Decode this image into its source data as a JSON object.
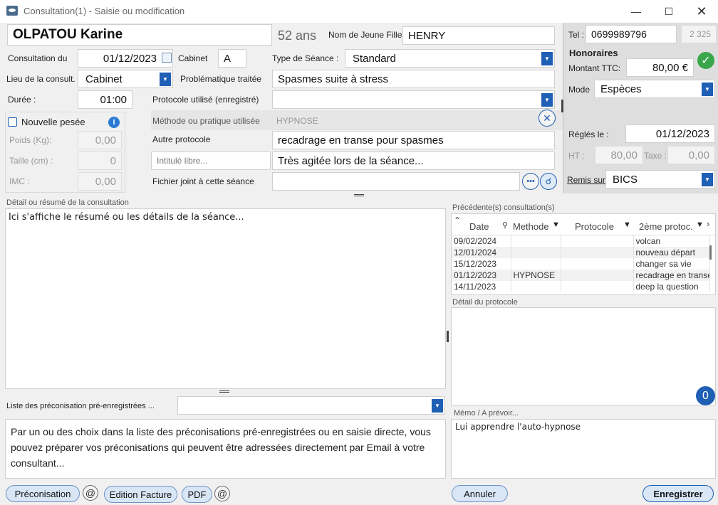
{
  "window": {
    "title": "Consultation(1) - Saisie ou modification"
  },
  "patient": {
    "name": "OLPATOU Karine",
    "age": "52 ans",
    "maiden_label": "Nom de Jeune Fille",
    "maiden_value": "HENRY"
  },
  "form": {
    "consult_date_label": "Consultation du",
    "consult_date": "01/12/2023",
    "cabinet_label": "Cabinet",
    "cabinet": "A",
    "session_type_label": "Type de Séance :",
    "session_type": "Standard",
    "place_label": "Lieu de la consult.",
    "place": "Cabinet",
    "problem_label": "Problématique traitée",
    "problem": "Spasmes suite à stress",
    "duration_label": "Durée :",
    "duration": "01:00",
    "protocol_label": "Protocole utilisé (enregistré)",
    "protocol": "",
    "method_label": "Méthode ou pratique utilisée",
    "method": "HYPNOSE",
    "other_protocol_label": "Autre protocole",
    "other_protocol": "recadrage en transe pour spasmes",
    "free_title_placeholder": "Intitulé libre...",
    "free_title_value": "Très agitée lors de la séance...",
    "attached_label": "Fichier joint à cette séance",
    "attached": ""
  },
  "weigh": {
    "new_label": "Nouvelle pesée",
    "weight_label": "Poids (Kg):",
    "weight": "0,00",
    "height_label": "Taille (cm) :",
    "height": "0",
    "imc_label": "IMC :",
    "imc": "0,00"
  },
  "billing": {
    "tel_label": "Tel :",
    "tel": "0699989796",
    "code": "2 325",
    "fees_title": "Honoraires",
    "amount_label": "Montant TTC:",
    "amount": "80,00 €",
    "mode_label": "Mode",
    "mode": "Espèces",
    "paid_label": "Réglés le :",
    "paid_date": "01/12/2023",
    "ht_label": "HT :",
    "ht": "80,00",
    "tax_label": "Taxe :",
    "tax": "0,00",
    "remis_label": "Remis sur",
    "remis": "BICS"
  },
  "detail": {
    "label": "Détail ou résumé de la consultation",
    "text": "Ici s'affiche le résumé ou les détails de la séance..."
  },
  "history": {
    "label": "Précédente(s) consultation(s)",
    "columns": [
      "Date",
      "Methode",
      "Protocole",
      "2ème protoc."
    ],
    "rows": [
      {
        "date": "09/02/2024",
        "method": "",
        "protocol": "",
        "second": "volcan"
      },
      {
        "date": "12/01/2024",
        "method": "",
        "protocol": "",
        "second": "nouveau départ"
      },
      {
        "date": "15/12/2023",
        "method": "",
        "protocol": "",
        "second": "changer sa vie"
      },
      {
        "date": "01/12/2023",
        "method": "HYPNOSE",
        "protocol": "",
        "second": "recadrage en transe"
      },
      {
        "date": "14/11/2023",
        "method": "",
        "protocol": "",
        "second": "deep la question"
      }
    ]
  },
  "protocol_detail": {
    "label": "Détail du protocole",
    "badge": "0"
  },
  "preco": {
    "list_label": "Liste des préconisation pré-enregistrées ...",
    "text": "Par un ou des choix dans la liste des préconisations pré-enregistrées ou en saisie directe, vous pouvez préparer vos préconisations qui peuvent être adressées directement par Email à votre consultant..."
  },
  "memo": {
    "label": "Mémo / A prévoir...",
    "text": "Lui apprendre l'auto-hypnose"
  },
  "buttons": {
    "preco": "Préconisation",
    "invoice": "Edition Facture",
    "pdf": "PDF",
    "cancel": "Annuler",
    "save": "Enregistrer",
    "at": "@"
  },
  "colors": {
    "accent": "#1f5fb4",
    "ok": "#3aa64a"
  }
}
